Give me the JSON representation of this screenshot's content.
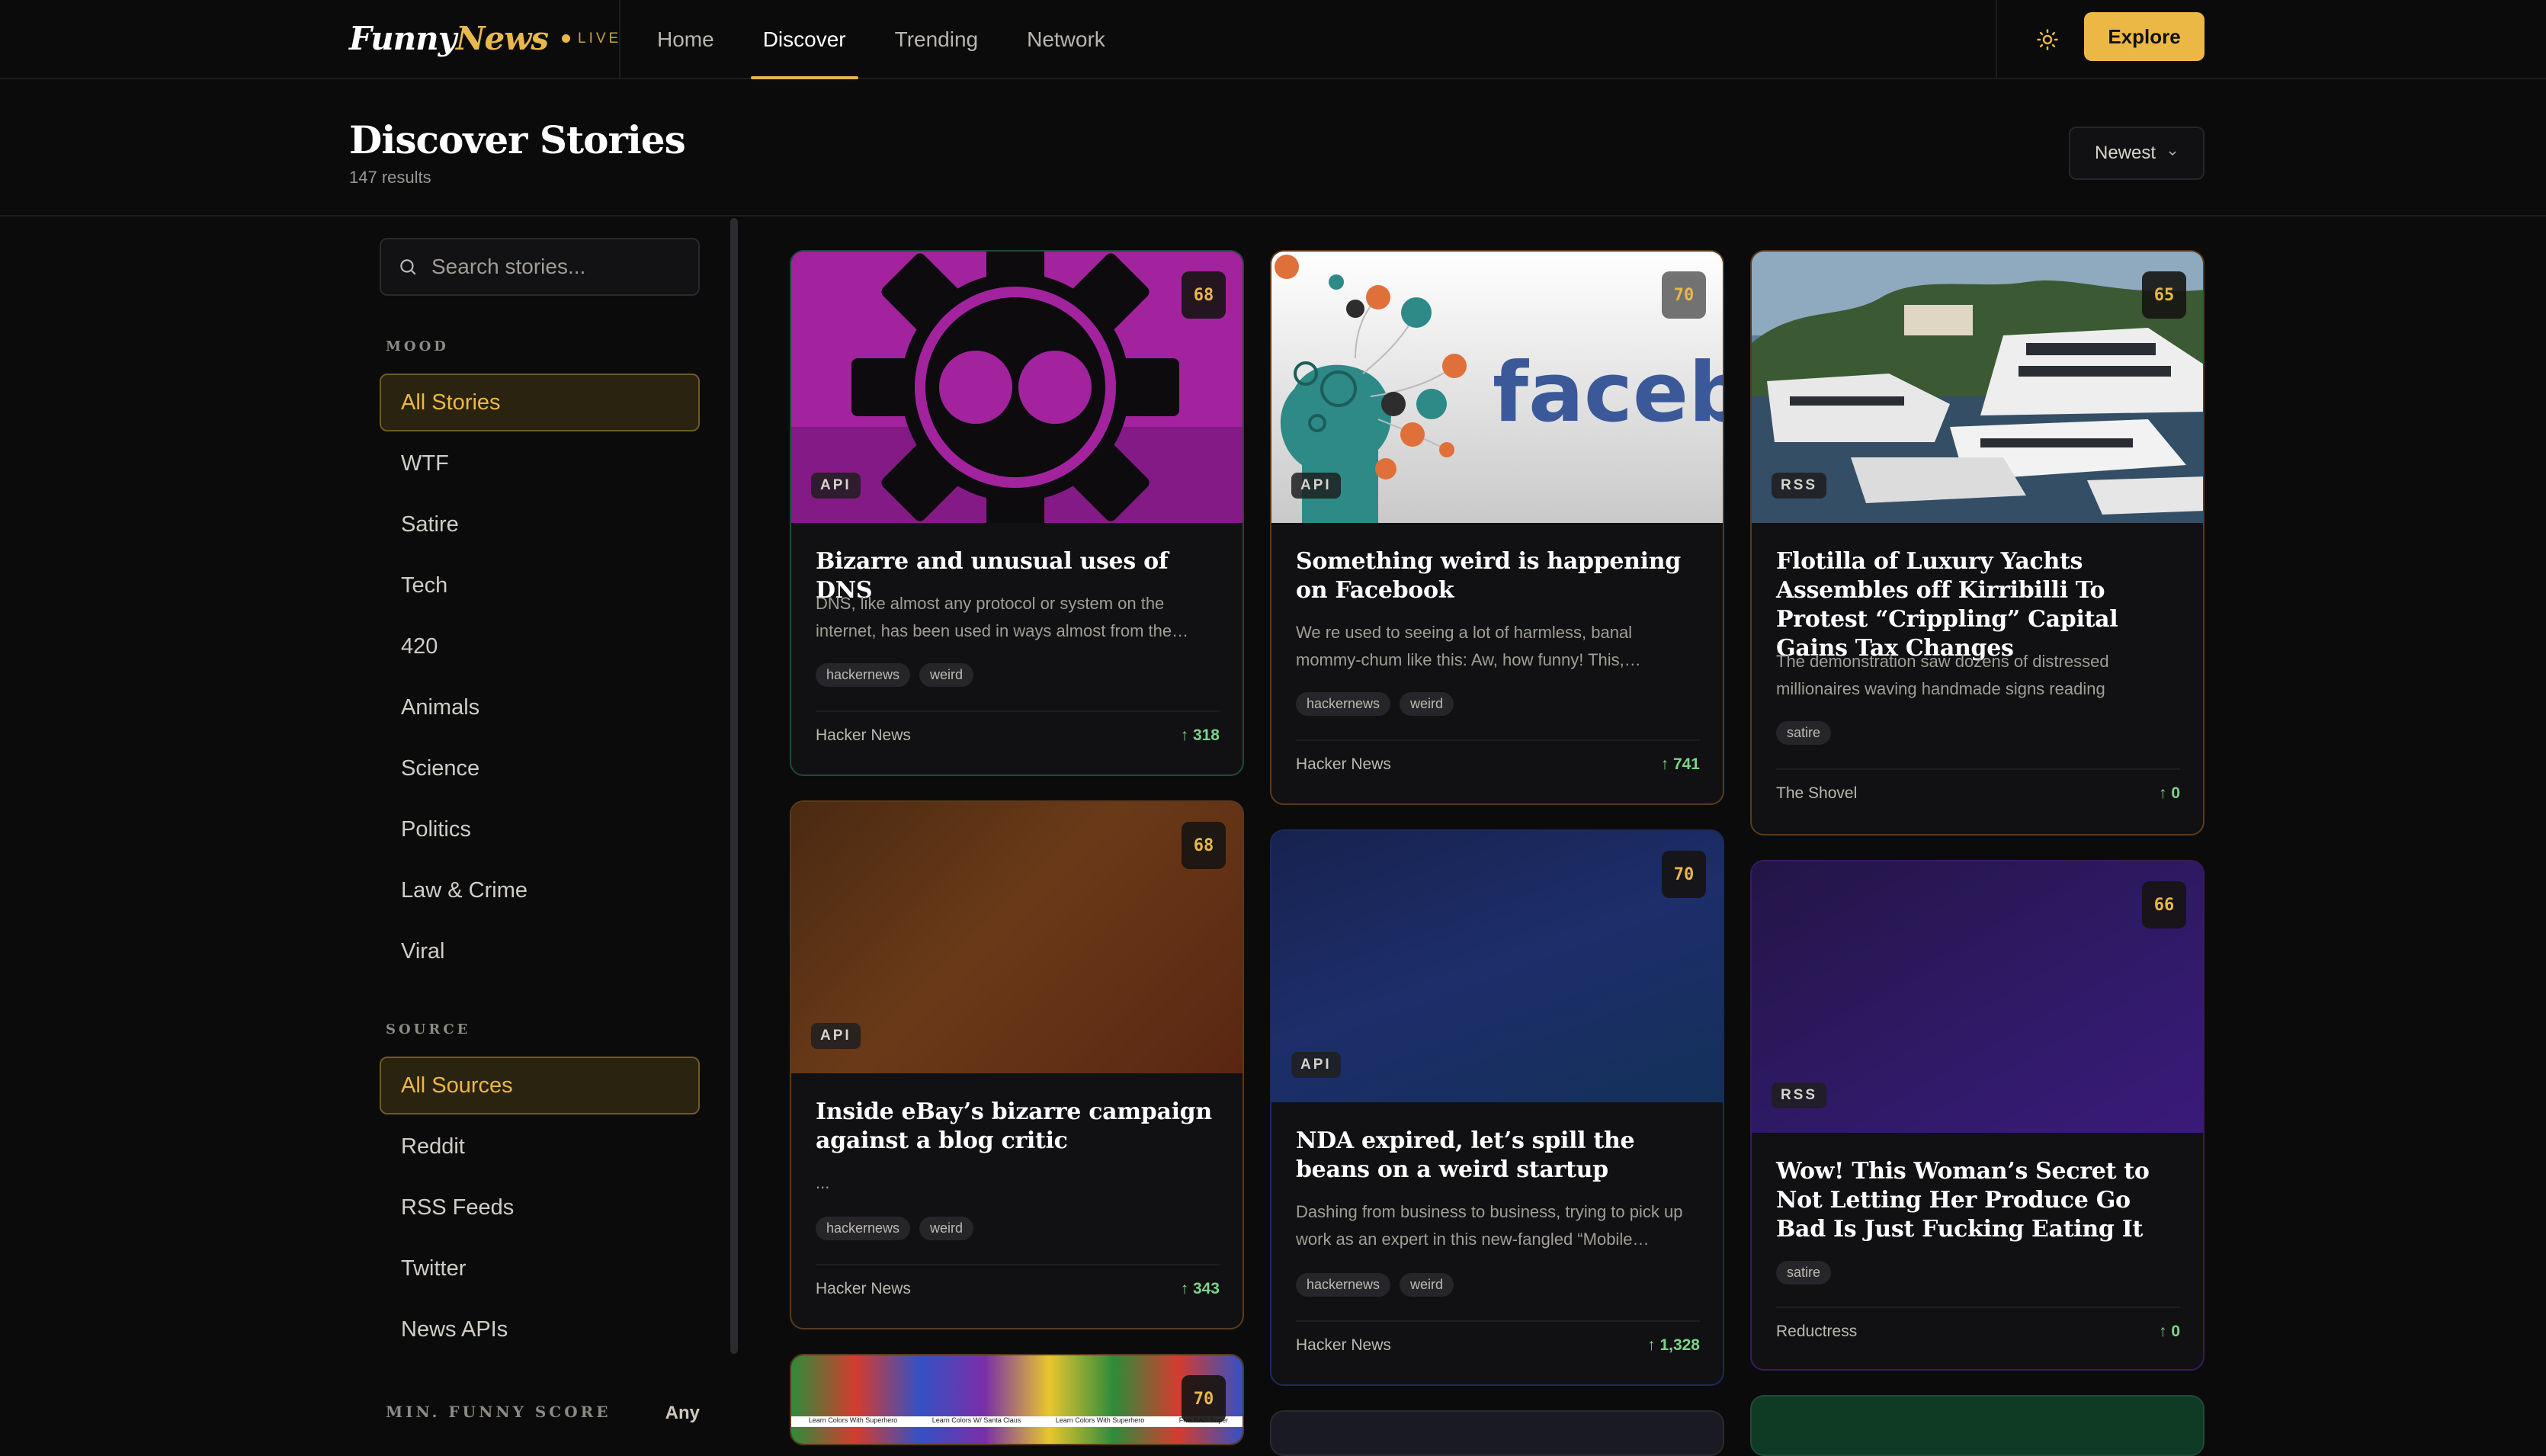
{
  "header": {
    "brand_funny": "Funny",
    "brand_news": "News",
    "live_label": "LIVE",
    "nav": [
      {
        "label": "Home"
      },
      {
        "label": "Discover",
        "active": true
      },
      {
        "label": "Trending"
      },
      {
        "label": "Network"
      }
    ],
    "theme_icon": "sun-icon",
    "explore_label": "Explore",
    "accent_color": "#ecb845"
  },
  "page": {
    "title": "Discover Stories",
    "results": "147 results",
    "sort_label": "Newest"
  },
  "sidebar": {
    "search_placeholder": "Search stories...",
    "mood_label": "MOOD",
    "moods": [
      "All Stories",
      "WTF",
      "Satire",
      "Tech",
      "420",
      "Animals",
      "Science",
      "Politics",
      "Law & Crime",
      "Viral"
    ],
    "source_label": "SOURCE",
    "sources": [
      "All Sources",
      "Reddit",
      "RSS Feeds",
      "Twitter",
      "News APIs"
    ],
    "score_label": "MIN. FUNNY SCORE",
    "score_value": "Any"
  },
  "cards": [
    {
      "score": "68",
      "source_badge": "API",
      "title": "Bizarre and unusual uses of DNS",
      "desc": "DNS, like almost any protocol or system on the internet, has been used in ways almost from the…",
      "tags": [
        "hackernews",
        "weird"
      ],
      "source": "Hacker News",
      "upvotes": "318",
      "border": "#1f4a3a"
    },
    {
      "score": "70",
      "source_badge": "API",
      "title": "Something weird is happening on Facebook",
      "desc": "We re used to seeing a lot of harmless, banal mommy-chum like this: Aw, how funny! This,…",
      "tags": [
        "hackernews",
        "weird"
      ],
      "source": "Hacker News",
      "upvotes": "741",
      "border": "#5a3a1c",
      "image_text": "facebo"
    },
    {
      "score": "65",
      "source_badge": "RSS",
      "title": "Flotilla of Luxury Yachts Assembles off Kirribilli To Protest “Crippling” Capital Gains Tax Changes",
      "desc": "The demonstration saw dozens of distressed millionaires waving handmade signs reading “HOW…",
      "tags": [
        "satire"
      ],
      "source": "The Shovel",
      "upvotes": "0",
      "border": "#5a3a1c"
    },
    {
      "score": "68",
      "source_badge": "API",
      "title": "Inside eBay’s bizarre campaign against a blog critic",
      "desc": "...",
      "tags": [
        "hackernews",
        "weird"
      ],
      "source": "Hacker News",
      "upvotes": "343",
      "border": "#5a3a1c"
    },
    {
      "score": "70",
      "source_badge": "API",
      "title": "NDA expired, let’s spill the beans on a weird startup",
      "desc": "Dashing from business to business, trying to pick up work as an expert in this new-fangled “Mobile…",
      "tags": [
        "hackernews",
        "weird"
      ],
      "source": "Hacker News",
      "upvotes": "1,328",
      "border": "#1c2a5a"
    },
    {
      "score": "66",
      "source_badge": "RSS",
      "title": "Wow! This Woman’s Secret to Not Letting Her Produce Go Bad Is Just Fucking Eating It",
      "desc": "",
      "tags": [
        "satire"
      ],
      "source": "Reductress",
      "upvotes": "0",
      "border": "#3a1c5a"
    },
    {
      "score": "70",
      "image_labels": [
        "Learn Colors With Superhero",
        "Learn Colors W/ Santa Claus",
        "Learn Colors With Superhero",
        "Five BAD Super"
      ]
    }
  ]
}
